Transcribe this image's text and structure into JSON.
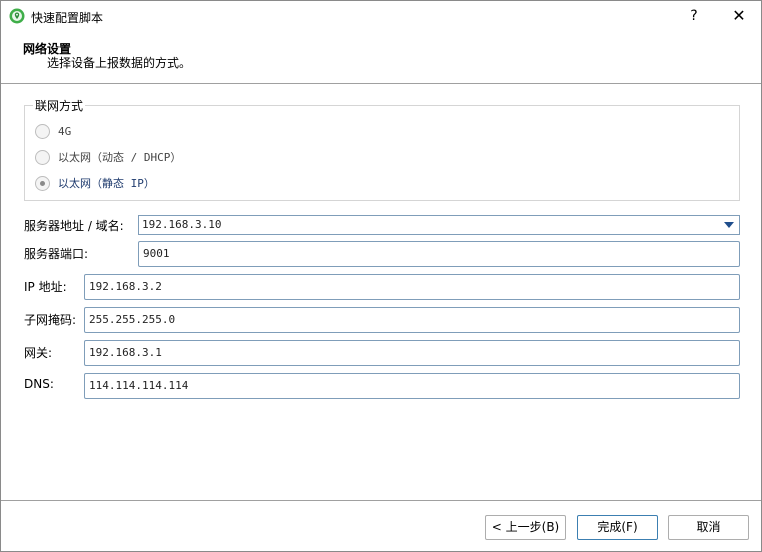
{
  "window": {
    "title": "快速配置脚本",
    "help_label": "?",
    "close_label": "✕"
  },
  "header": {
    "title": "网络设置",
    "subtitle": "选择设备上报数据的方式。"
  },
  "network_mode": {
    "legend": "联网方式",
    "options": [
      {
        "label": "4G",
        "selected": false
      },
      {
        "label": "以太网（动态 / DHCP）",
        "selected": false
      },
      {
        "label": "以太网（静态 IP）",
        "selected": true
      }
    ]
  },
  "form": {
    "server_address": {
      "label": "服务器地址 / 域名:",
      "value": "192.168.3.10"
    },
    "server_port": {
      "label": "服务器端口:",
      "value": "9001"
    },
    "ip_address": {
      "label": "IP 地址:",
      "value": "192.168.3.2"
    },
    "subnet_mask": {
      "label": "子网掩码:",
      "value": "255.255.255.0"
    },
    "gateway": {
      "label": "网关:",
      "value": "192.168.3.1"
    },
    "dns": {
      "label": "DNS:",
      "value": "114.114.114.114"
    }
  },
  "footer": {
    "back_label": "< 上一步(B)",
    "finish_label": "完成(F)",
    "cancel_label": "取消"
  },
  "colors": {
    "accent": "#3c7fb1",
    "input_border": "#7f9db9",
    "dropdown_arrow": "#1f4e8c"
  }
}
